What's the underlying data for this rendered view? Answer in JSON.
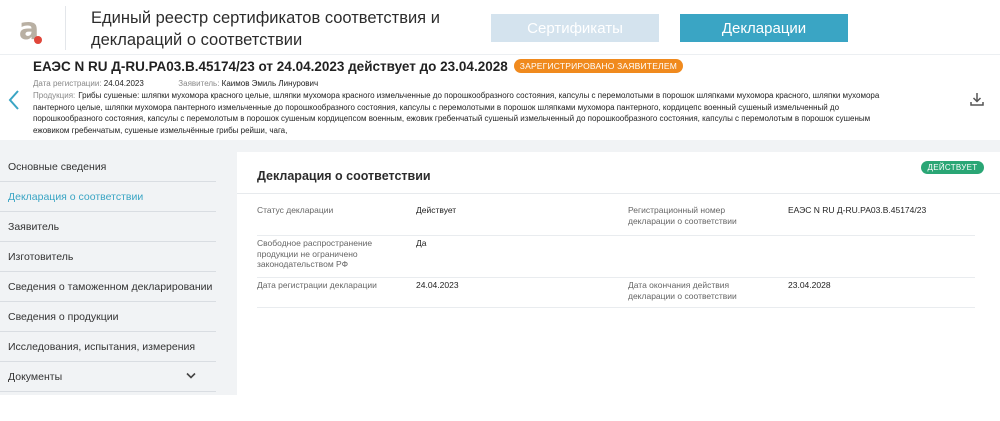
{
  "header": {
    "logo": "a-logo-icon",
    "site_title": "Единый реестр сертификатов соответствия и деклараций о соответствии",
    "tab_certificates": "Сертификаты",
    "tab_declarations": "Декларации",
    "colors": {
      "accent": "#3aa5c4",
      "tab_inactive": "#d4e3ee"
    }
  },
  "document": {
    "title": "ЕАЭС N RU Д-RU.РА03.В.45174/23 от 24.04.2023 действует до 23.04.2028",
    "status_pill": "ЗАРЕГИСТРИРОВАНО ЗАЯВИТЕЛЕМ",
    "reg_date_label": "Дата регистрации:",
    "reg_date": "24.04.2023",
    "applicant_label": "Заявитель:",
    "applicant": "Каимов Эмиль Линурович",
    "products_label": "Продукция:",
    "products": "Грибы сушеные: шляпки мухомора красного целые, шляпки мухомора красного измельченные до порошкообразного состояния, капсулы с перемолотыми в порошок шляпками мухомора красного, шляпки мухомора пантерного целые, шляпки мухомора пантерного измельченные до порошкообразного состояния, капсулы с перемолотыми в порошок шляпками мухомора пантерного, кордицепс военный сушеный измельченный до порошкообразного состояния, капсулы с перемолотым в порошок сушеным кордицепсом военным, ежовик гребенчатый сушеный измельченный до порошкообразного состояния, капсулы с перемолотым в порошок сушеным ежовиком гребенчатым, сушеные измельчённые грибы рейши, чага,",
    "pill_color": "#f08a1e"
  },
  "sidebar": {
    "items": [
      {
        "label": "Основные сведения"
      },
      {
        "label": "Декларация о соответствии"
      },
      {
        "label": "Заявитель"
      },
      {
        "label": "Изготовитель"
      },
      {
        "label": "Сведения о таможенном декларировании"
      },
      {
        "label": "Сведения о продукции"
      },
      {
        "label": "Исследования, испытания, измерения"
      },
      {
        "label": "Документы"
      }
    ],
    "active_index": 1
  },
  "card": {
    "title": "Декларация о соответствии",
    "badge": "ДЕЙСТВУЕТ",
    "badge_color": "#2aa675",
    "rows": [
      {
        "label1": "Статус декларации",
        "value1": "Действует",
        "label2": "Регистрационный номер декларации о соответствии",
        "value2": "ЕАЭС N RU Д-RU.РА03.В.45174/23"
      },
      {
        "label1": "Свободное распространение продукции не ограничено законодательством РФ",
        "value1": "Да"
      },
      {
        "label1": "Дата регистрации декларации",
        "value1": "24.04.2023",
        "label2": "Дата окончания действия декларации о соответствии",
        "value2": "23.04.2028"
      }
    ]
  }
}
